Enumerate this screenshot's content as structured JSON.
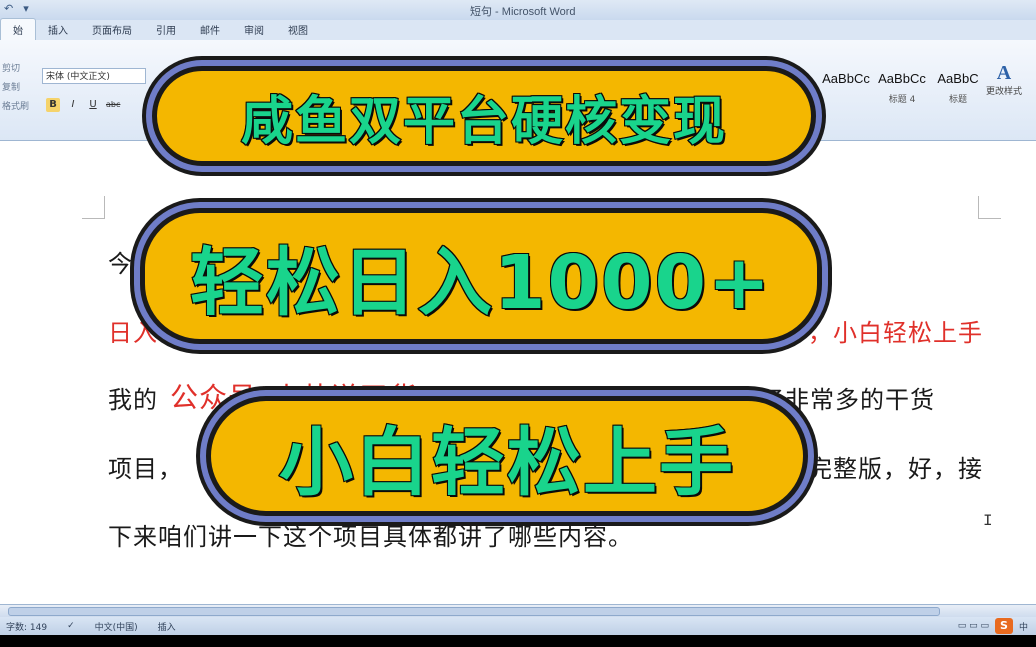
{
  "window": {
    "title": "短句 - Microsoft Word",
    "qat_icons": [
      "undo-icon",
      "save-icon"
    ]
  },
  "ribbon": {
    "tabs": [
      "始",
      "插入",
      "页面布局",
      "引用",
      "邮件",
      "审阅",
      "视图"
    ],
    "clipboard_labels": [
      "剪切",
      "复制",
      "格式刷"
    ],
    "font_name": "宋体 (中文正文)",
    "format_buttons": [
      "B",
      "I",
      "U",
      "abc"
    ],
    "styles": [
      {
        "preview": "AaBbCc",
        "name": ""
      },
      {
        "preview": "AaBbCc",
        "name": "标题 4"
      },
      {
        "preview": "AaBbC",
        "name": "标题"
      }
    ],
    "change_styles_label": "更改样式"
  },
  "document": {
    "line1_start": "今",
    "line2_start": "日入",
    "line2_end": "，小白轻松上手",
    "line3_a": "我的",
    "line3_red": "公众号“小帅说干货”",
    "line3_b": "上面有给大家分享了非常多的干货",
    "line4_a": "项目，",
    "line4_b": "完整版，好，接",
    "line5": "下来咱们讲一下这个项目具体都讲了哪些内容。"
  },
  "status": {
    "word_count": "字数: 149",
    "language": "中文(中国)",
    "mode": "插入",
    "ime": "中"
  },
  "overlay": {
    "headline1": "咸鱼双平台硬核变现",
    "headline2": "轻松日入1000+",
    "headline3": "小白轻松上手"
  },
  "colors": {
    "pill_fill": "#f4b700",
    "pill_text": "#19d48c",
    "pill_ring": "#6f7dc8",
    "red_text": "#e0302a"
  }
}
